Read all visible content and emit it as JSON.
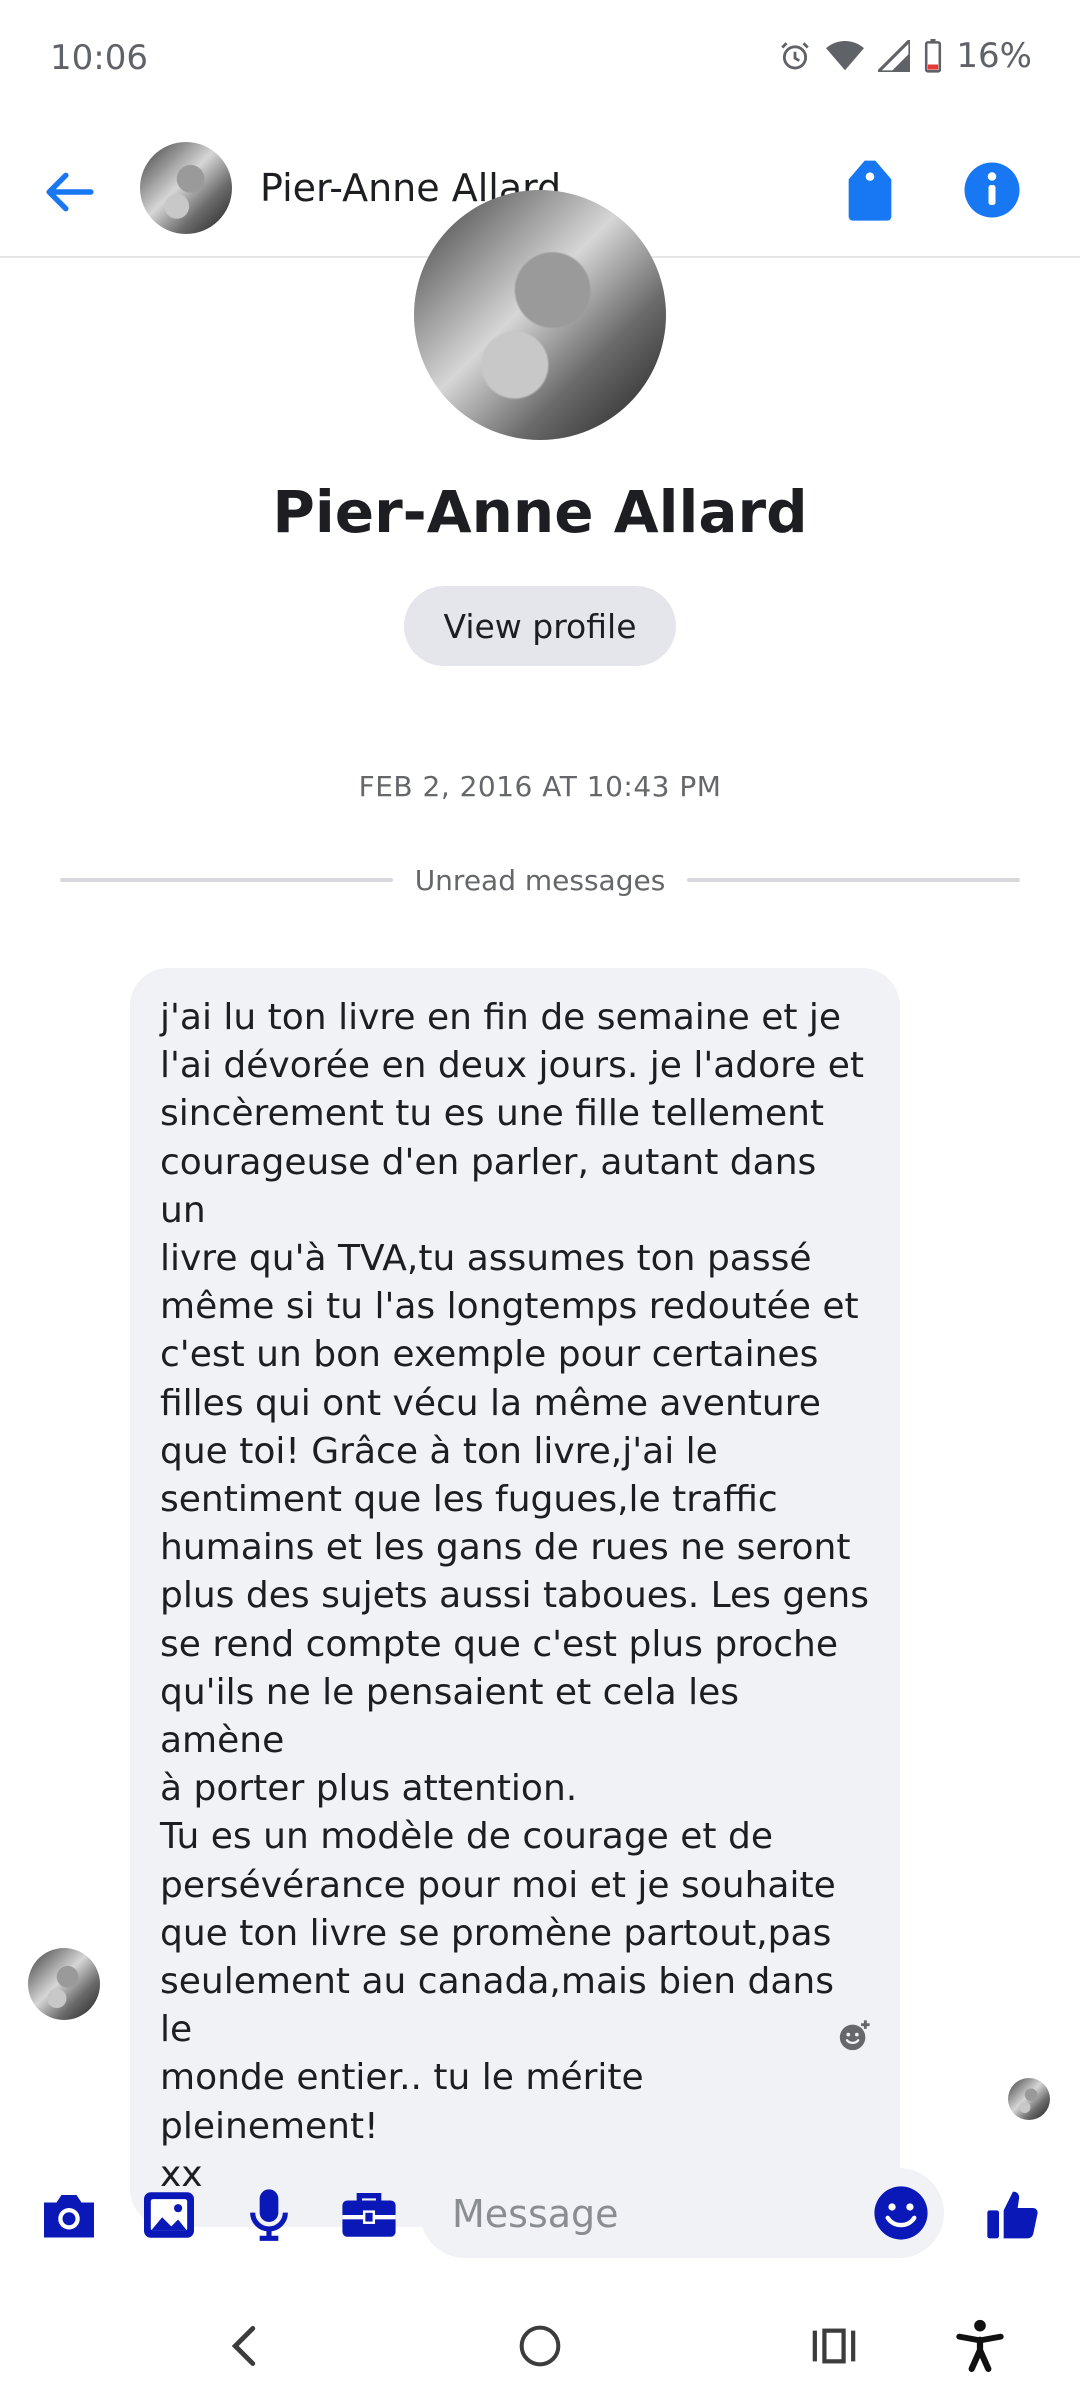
{
  "status_bar": {
    "time": "10:06",
    "battery": "16%",
    "icons": [
      "alarm-icon",
      "wifi-icon",
      "signal-icon",
      "battery-icon"
    ]
  },
  "header": {
    "contact_name": "Pier-Anne Allard",
    "icons": [
      "back-arrow-icon",
      "tag-icon",
      "info-icon"
    ]
  },
  "profile": {
    "name": "Pier-Anne Allard",
    "view_profile_label": "View profile"
  },
  "conversation": {
    "timestamp": "FEB 2, 2016 AT 10:43 PM",
    "unread_label": "Unread messages",
    "messages": [
      {
        "from": "contact",
        "text": "j'ai lu ton livre en fin de semaine et je\nl'ai dévorée en deux jours. je l'adore et\nsincèrement tu es une fille tellement\ncourageuse d'en parler, autant dans un\nlivre qu'à TVA,tu assumes ton passé\nmême si tu l'as longtemps redoutée et\nc'est un bon exemple pour certaines\nfilles qui ont vécu la même aventure\nque toi! Grâce à ton livre,j'ai le\nsentiment que les fugues,le traffic\nhumains et les gans de rues ne seront\nplus des sujets aussi taboues. Les gens\nse rend compte que c'est plus proche\nqu'ils ne le pensaient et cela les amène\nà porter plus attention.\nTu es un modèle de courage et de\npersévérance pour moi et je souhaite\nque ton livre se promène partout,pas\nseulement au canada,mais bien dans le\nmonde entier.. tu le mérite pleinement!\nxx"
      }
    ]
  },
  "composer": {
    "placeholder": "Message",
    "icons": [
      "camera-icon",
      "gallery-icon",
      "microphone-icon",
      "briefcase-icon",
      "emoji-icon",
      "thumbs-up-icon"
    ]
  },
  "nav_bar": {
    "icons": [
      "nav-back-icon",
      "home-icon",
      "recents-icon",
      "accessibility-icon"
    ]
  },
  "colors": {
    "accent": "#1877f2",
    "composer_accent": "#0a18b8",
    "bubble": "#f0f2f5"
  }
}
